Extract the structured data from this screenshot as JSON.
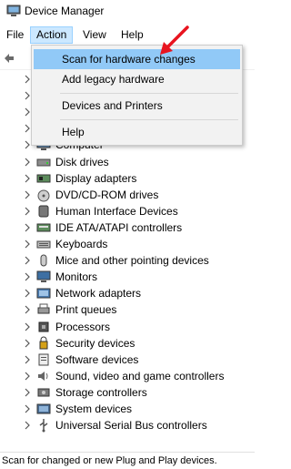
{
  "window": {
    "title": "Device Manager"
  },
  "menubar": {
    "items": [
      "File",
      "Action",
      "View",
      "Help"
    ]
  },
  "action_menu": {
    "items": [
      {
        "label": "Scan for hardware changes",
        "highlighted": true
      },
      {
        "label": "Add legacy hardware"
      },
      {
        "label": "Devices and Printers"
      },
      {
        "label": "Help"
      }
    ]
  },
  "tree": {
    "categories": [
      {
        "label": "",
        "icon": "generic-device-icon"
      },
      {
        "label": "",
        "icon": "generic-device-icon"
      },
      {
        "label": "",
        "icon": "generic-device-icon"
      },
      {
        "label": "",
        "icon": "generic-device-icon"
      },
      {
        "label": "Computer",
        "icon": "computer-icon"
      },
      {
        "label": "Disk drives",
        "icon": "disk-drive-icon"
      },
      {
        "label": "Display adapters",
        "icon": "display-adapter-icon"
      },
      {
        "label": "DVD/CD-ROM drives",
        "icon": "dvd-drive-icon"
      },
      {
        "label": "Human Interface Devices",
        "icon": "hid-icon"
      },
      {
        "label": "IDE ATA/ATAPI controllers",
        "icon": "ide-controller-icon"
      },
      {
        "label": "Keyboards",
        "icon": "keyboard-icon"
      },
      {
        "label": "Mice and other pointing devices",
        "icon": "mouse-icon"
      },
      {
        "label": "Monitors",
        "icon": "monitor-icon"
      },
      {
        "label": "Network adapters",
        "icon": "network-adapter-icon"
      },
      {
        "label": "Print queues",
        "icon": "printer-icon"
      },
      {
        "label": "Processors",
        "icon": "processor-icon"
      },
      {
        "label": "Security devices",
        "icon": "security-device-icon"
      },
      {
        "label": "Software devices",
        "icon": "software-device-icon"
      },
      {
        "label": "Sound, video and game controllers",
        "icon": "speaker-icon"
      },
      {
        "label": "Storage controllers",
        "icon": "storage-controller-icon"
      },
      {
        "label": "System devices",
        "icon": "system-device-icon"
      },
      {
        "label": "Universal Serial Bus controllers",
        "icon": "usb-icon"
      }
    ]
  },
  "statusbar": {
    "text": "Scan for changed or new Plug and Play devices."
  },
  "colors": {
    "menu_highlight": "#91c9f7",
    "menu_active": "#cce8ff",
    "arrow": "#e8141f"
  }
}
